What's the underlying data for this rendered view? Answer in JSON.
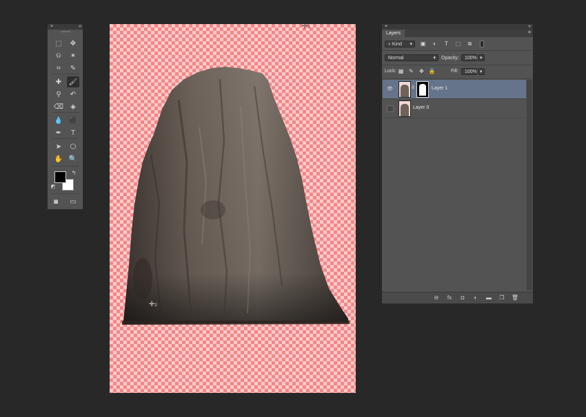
{
  "tools_panel": {
    "close_glyph": "×",
    "collapse_glyph": "«",
    "tools": [
      {
        "name": "marquee-tool-icon",
        "glyph": "⬚"
      },
      {
        "name": "move-tool-icon",
        "glyph": "✥"
      },
      {
        "name": "lasso-tool-icon",
        "glyph": "ଡ"
      },
      {
        "name": "magic-wand-tool-icon",
        "glyph": "✶"
      },
      {
        "name": "crop-tool-icon",
        "glyph": "⌗"
      },
      {
        "name": "eyedropper-tool-icon",
        "glyph": "✎"
      },
      {
        "name": "healing-brush-tool-icon",
        "glyph": "✚"
      },
      {
        "name": "brush-tool-icon",
        "glyph": "🖌"
      },
      {
        "name": "clone-stamp-tool-icon",
        "glyph": "⚲"
      },
      {
        "name": "history-brush-tool-icon",
        "glyph": "↶"
      },
      {
        "name": "eraser-tool-icon",
        "glyph": "⌫"
      },
      {
        "name": "paint-bucket-tool-icon",
        "glyph": "◈"
      },
      {
        "name": "blur-tool-icon",
        "glyph": "💧"
      },
      {
        "name": "dodge-tool-icon",
        "glyph": "⚫"
      },
      {
        "name": "pen-tool-icon",
        "glyph": "✒"
      },
      {
        "name": "type-tool-icon",
        "glyph": "T"
      },
      {
        "name": "path-selection-tool-icon",
        "glyph": "➤"
      },
      {
        "name": "shape-tool-icon",
        "glyph": "⬡"
      },
      {
        "name": "hand-tool-icon",
        "glyph": "✋"
      },
      {
        "name": "zoom-tool-icon",
        "glyph": "🔍"
      }
    ],
    "swap_glyph": "↰",
    "default_colors_glyph": "◩",
    "quick_mask_glyph": "◙",
    "screen_mode_glyph": "▭",
    "foreground_color": "#000000",
    "background_color": "#ffffff"
  },
  "canvas": {
    "cursor_top_label": "3",
    "cursor_bottom_label": "2"
  },
  "layers_panel": {
    "close_glyph": "×",
    "collapse_glyph": "«",
    "tab_label": "Layers",
    "menu_glyph": "≡",
    "filter": {
      "search_glyph": "⌕",
      "kind_label": "Kind"
    },
    "filter_icons": [
      {
        "name": "pixel-filter-icon",
        "glyph": "▣"
      },
      {
        "name": "adjustment-filter-icon",
        "glyph": "◐"
      },
      {
        "name": "type-filter-icon",
        "glyph": "T"
      },
      {
        "name": "shape-filter-icon",
        "glyph": "⬚"
      },
      {
        "name": "smart-object-filter-icon",
        "glyph": "⧉"
      }
    ],
    "blend_mode": "Normal",
    "opacity_label": "Opacity:",
    "opacity_value": "100%",
    "lock_label": "Lock:",
    "lock_icons": [
      {
        "name": "lock-transparent-icon",
        "glyph": "▦"
      },
      {
        "name": "lock-image-icon",
        "glyph": "✎"
      },
      {
        "name": "lock-position-icon",
        "glyph": "✥"
      },
      {
        "name": "lock-all-icon",
        "glyph": "🔒"
      }
    ],
    "fill_label": "Fill:",
    "fill_value": "100%",
    "dropdown_glyph": "▾",
    "layers": [
      {
        "name": "Layer 1",
        "selected": true,
        "visible": true,
        "has_mask": true
      },
      {
        "name": "Layer 0",
        "selected": false,
        "visible": false,
        "has_mask": false
      }
    ],
    "eye_glyph": "👁",
    "chain_glyph": "8",
    "footer_buttons": [
      {
        "name": "link-layers-icon",
        "glyph": "⊖"
      },
      {
        "name": "fx-icon",
        "glyph": "fx"
      },
      {
        "name": "add-mask-icon",
        "glyph": "◘"
      },
      {
        "name": "adjustment-layer-icon",
        "glyph": "◐"
      },
      {
        "name": "new-group-icon",
        "glyph": "▬"
      },
      {
        "name": "new-layer-icon",
        "glyph": "❐"
      },
      {
        "name": "delete-layer-icon",
        "glyph": "🗑"
      }
    ]
  }
}
